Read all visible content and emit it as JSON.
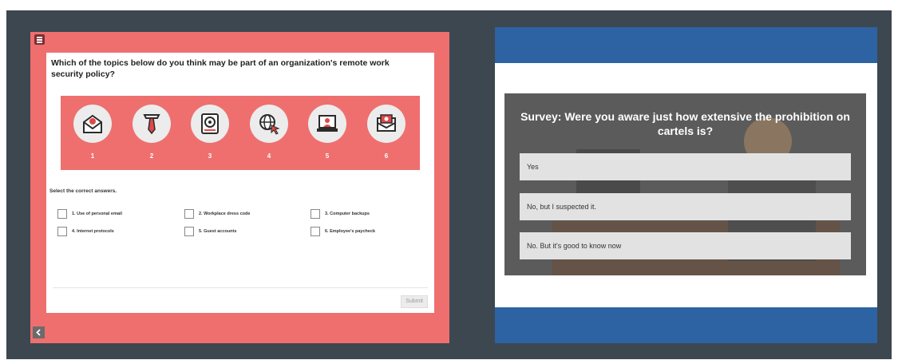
{
  "quiz": {
    "question": "Which of the topics below do you think may be part of an organization's remote work security policy?",
    "topics": [
      {
        "number": "1",
        "icon": "envelope-person-icon"
      },
      {
        "number": "2",
        "icon": "tie-icon"
      },
      {
        "number": "3",
        "icon": "hard-drive-icon"
      },
      {
        "number": "4",
        "icon": "globe-cursor-icon"
      },
      {
        "number": "5",
        "icon": "laptop-user-icon"
      },
      {
        "number": "6",
        "icon": "cash-envelope-icon"
      }
    ],
    "instruction": "Select the correct answers.",
    "options": [
      "1. Use of personal email",
      "2. Workplace dress code",
      "3. Computer backups",
      "4. Internet protocols",
      "5. Guest accounts",
      "6. Employee's paycheck"
    ],
    "submit_label": "Submit"
  },
  "survey": {
    "title": "Survey: Were you aware just how extensive the prohibition on cartels is?",
    "answers": [
      "Yes",
      "No, but I suspected it.",
      "No. But it's good to know now"
    ]
  },
  "colors": {
    "coral": "#ef6f6f",
    "frame": "#3c4750",
    "blue": "#2d63a3",
    "icon_dark": "#2b2b2b",
    "icon_red": "#e04848"
  }
}
